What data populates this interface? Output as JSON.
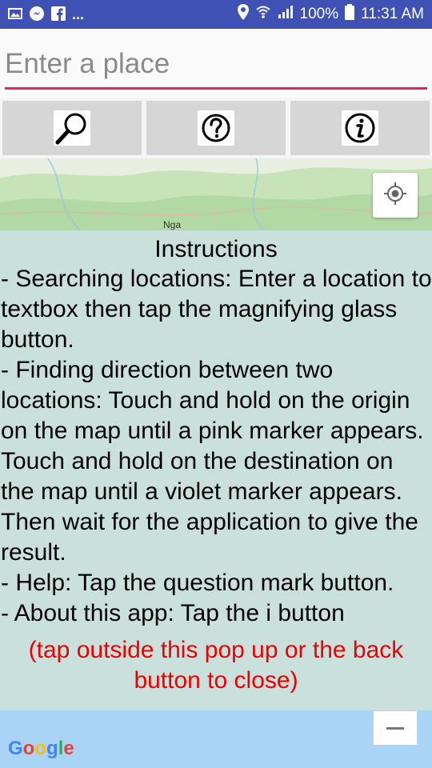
{
  "status": {
    "battery": "100%",
    "time": "11:31 AM",
    "notification_more": "..."
  },
  "search": {
    "placeholder": "Enter a place",
    "value": ""
  },
  "toolbar": {
    "search_icon": "magnifying-glass",
    "help_icon": "question-mark",
    "info_icon": "info-i"
  },
  "map": {
    "label": "Nga",
    "logo_text": "Google"
  },
  "popup": {
    "title": "Instructions",
    "paragraphs": [
      "- Searching locations: Enter a location to textbox then tap the magnifying glass button.",
      "- Finding direction between two locations: Touch and hold on the origin on the map until a pink marker appears. Touch and hold on the destination on the map until a violet marker appears. Then wait for the application to give the result.",
      "- Help: Tap the question mark button.",
      "- About this app: Tap the i button"
    ],
    "close_note": "(tap outside this pop up or the back button to close)"
  },
  "colors": {
    "statusbar": "#3f51b5",
    "accent_underline": "#e91e63",
    "popup_bg": "#cae0dc",
    "note_red": "#ee0000"
  }
}
